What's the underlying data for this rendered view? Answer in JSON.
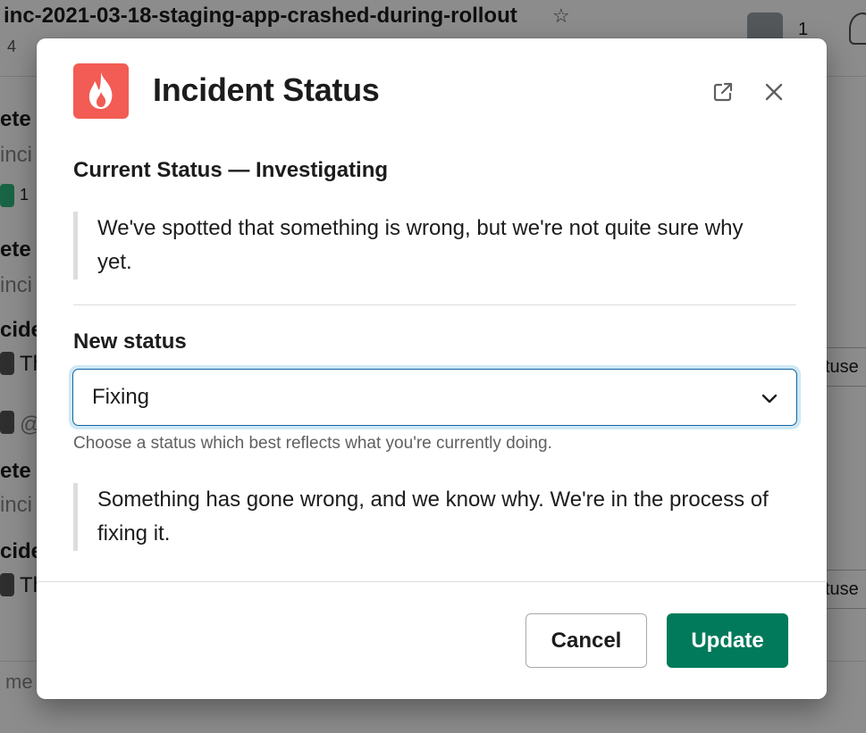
{
  "background": {
    "channel_name": "inc-2021-03-18-staging-app-crashed-during-rollout",
    "member_count_partial": "4",
    "member_count": "1",
    "left_fragments": [
      "ete",
      "inci",
      "1",
      "ete",
      "inci",
      "cide",
      "Th",
      "@",
      "ete",
      "inci",
      "cide",
      "Th"
    ],
    "right_button_fragment": "tuse",
    "composer_fragment": "me"
  },
  "modal": {
    "title": "Incident Status",
    "current_status_heading": "Current Status — Investigating",
    "current_status_description": "We've spotted that something is wrong, but we're not quite sure why yet.",
    "new_status_label": "New status",
    "select": {
      "value": "Fixing"
    },
    "hint": "Choose a status which best reflects what you're currently doing.",
    "new_status_description": "Something has gone wrong, and we know why. We're in the process of fixing it.",
    "cancel_label": "Cancel",
    "update_label": "Update"
  },
  "colors": {
    "app_icon_bg": "#f25c54",
    "primary_button": "#007a5a",
    "focus_ring": "#cfe8f5",
    "select_border": "#1264a3"
  },
  "icons": {
    "app": "flame-icon",
    "open_external": "external-link-icon",
    "close": "close-icon",
    "select": "chevron-down-icon"
  }
}
